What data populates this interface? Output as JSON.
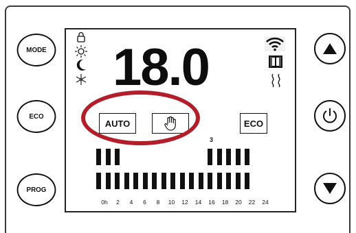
{
  "buttons": {
    "mode_label": "MODE",
    "eco_label": "ECO",
    "prog_label": "PROG"
  },
  "display": {
    "temperature": "18.0",
    "auto_label": "AUTO",
    "eco_label": "ECO",
    "time_marker": "3",
    "icons": [
      "lock-icon",
      "sun-icon",
      "moon-icon",
      "snowflake-icon",
      "wifi-icon",
      "window-icon",
      "heat-icon",
      "hand-icon"
    ],
    "program_top_hours": [
      0,
      1,
      2,
      12,
      13,
      14,
      15,
      16
    ],
    "program_bottom_hours": [
      0,
      1,
      2,
      3,
      4,
      5,
      6,
      7,
      8,
      9,
      10,
      11,
      12,
      13,
      14,
      15,
      16
    ],
    "hour_labels": [
      "0h",
      "2",
      "4",
      "6",
      "8",
      "10",
      "12",
      "14",
      "16",
      "18",
      "20",
      "22",
      "24"
    ]
  },
  "colors": {
    "highlight": "#b21e2a",
    "ink": "#111111"
  }
}
